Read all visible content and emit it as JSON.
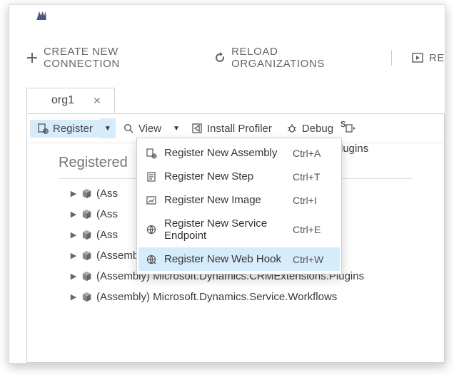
{
  "toolbar": {
    "create_label": "CREATE NEW CONNECTION",
    "reload_label": "RELOAD ORGANIZATIONS",
    "replay_partial": "RE"
  },
  "tab": {
    "title": "org1"
  },
  "ribbon": {
    "register_label": "Register",
    "view_label": "View",
    "install_label": "Install Profiler",
    "debug_label": "Debug"
  },
  "section_title": "Registered",
  "menu": {
    "items": [
      {
        "label": "Register New Assembly",
        "shortcut": "Ctrl+A"
      },
      {
        "label": "Register New Step",
        "shortcut": "Ctrl+T"
      },
      {
        "label": "Register New Image",
        "shortcut": "Ctrl+I"
      },
      {
        "label": "Register New Service Endpoint",
        "shortcut": "Ctrl+E"
      },
      {
        "label": "Register New Web Hook",
        "shortcut": "Ctrl+W"
      }
    ],
    "highlighted_index": 4
  },
  "tree": {
    "nodes": [
      "(Ass",
      "(Ass",
      "(Ass",
      "(Assembly) ActivityAnalysisPlugins.Merged",
      "(Assembly) Microsoft.Dynamics.CRMExtensions.Plugins",
      "(Assembly) Microsoft.Dynamics.Service.Workflows"
    ],
    "occluded_suffix": [
      "",
      "s",
      "lugins",
      "",
      "",
      ""
    ]
  }
}
